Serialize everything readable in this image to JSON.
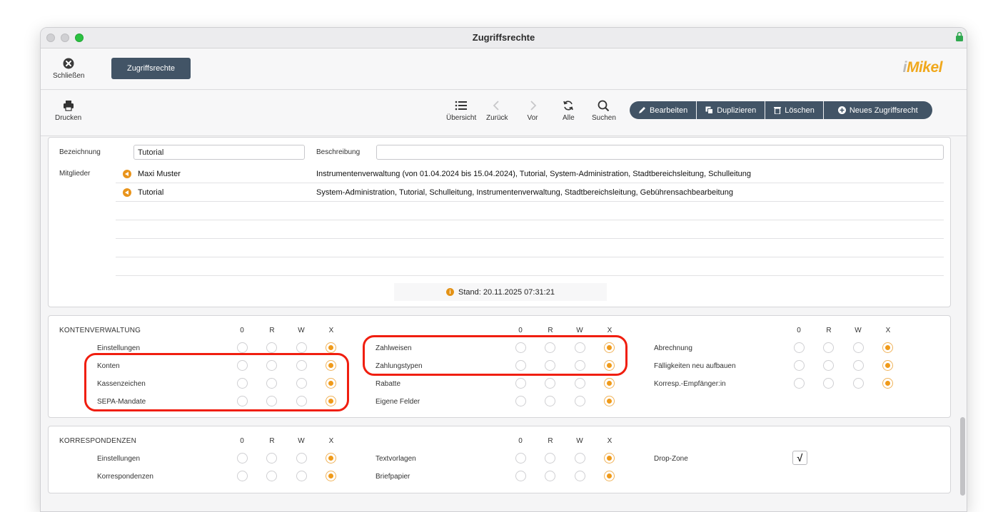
{
  "window": {
    "title": "Zugriffsrechte"
  },
  "topbar": {
    "close_label": "Schließen",
    "tab_label": "Zugriffsrechte",
    "logo_i": "i",
    "logo_rest": "Mikel"
  },
  "toolbar": {
    "print_label": "Drucken",
    "overview_label": "Übersicht",
    "back_label": "Zurück",
    "forward_label": "Vor",
    "all_label": "Alle",
    "search_label": "Suchen",
    "edit_label": "Bearbeiten",
    "duplicate_label": "Duplizieren",
    "delete_label": "Löschen",
    "new_label": "Neues Zugriffsrecht"
  },
  "form": {
    "name_label": "Bezeichnung",
    "name_value": "Tutorial",
    "description_label": "Beschreibung",
    "description_value": "",
    "members_label": "Mitglieder",
    "members": [
      {
        "name": "Maxi Muster",
        "roles": "Instrumentenverwaltung (von 01.04.2024 bis 15.04.2024), Tutorial, System-Administration, Stadtbereichsleitung, Schulleitung"
      },
      {
        "name": "Tutorial",
        "roles": "System-Administration, Tutorial, Schulleitung, Instrumentenverwaltung, Stadtbereichsleitung, Gebührensachbearbeitung"
      }
    ],
    "stand": "Stand: 20.11.2025 07:31:21"
  },
  "rights_headers": [
    "0",
    "R",
    "W",
    "X"
  ],
  "kontenverwaltung": {
    "title": "KONTENVERWALTUNG",
    "col1": [
      {
        "label": "Einstellungen",
        "selected": "X"
      },
      {
        "label": "Konten",
        "selected": "X"
      },
      {
        "label": "Kassenzeichen",
        "selected": "X"
      },
      {
        "label": "SEPA-Mandate",
        "selected": "X"
      }
    ],
    "col2": [
      {
        "label": "Zahlweisen",
        "selected": "X"
      },
      {
        "label": "Zahlungstypen",
        "selected": "X"
      },
      {
        "label": "Rabatte",
        "selected": "X"
      },
      {
        "label": "Eigene Felder",
        "selected": "X"
      }
    ],
    "col3": [
      {
        "label": "Abrechnung",
        "selected": "X"
      },
      {
        "label": "Fälligkeiten neu aufbauen",
        "selected": "X"
      },
      {
        "label": "Korresp.-Empfänger:in",
        "selected": "X"
      }
    ]
  },
  "korrespondenzen": {
    "title": "KORRESPONDENZEN",
    "col1": [
      {
        "label": "Einstellungen",
        "selected": "X"
      },
      {
        "label": "Korrespondenzen",
        "selected": "X"
      }
    ],
    "col2": [
      {
        "label": "Textvorlagen",
        "selected": "X"
      },
      {
        "label": "Briefpapier",
        "selected": "X"
      }
    ],
    "dropzone": {
      "label": "Drop-Zone",
      "checked": true,
      "mark": "√"
    }
  },
  "colors": {
    "accent": "#ef9a1a",
    "button": "#425466",
    "highlight": "#f01e0f"
  }
}
